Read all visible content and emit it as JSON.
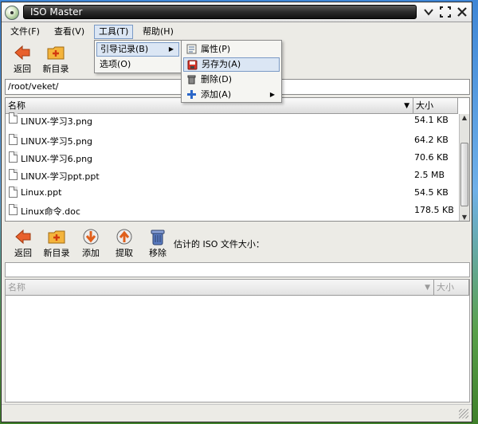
{
  "window": {
    "title": "ISO Master"
  },
  "window_controls": [
    "chevron-down-icon",
    "maximize-icon",
    "close-icon"
  ],
  "menubar": {
    "items": [
      {
        "label": "文件(F)"
      },
      {
        "label": "查看(V)"
      },
      {
        "label": "工具(T)"
      },
      {
        "label": "帮助(H)"
      }
    ]
  },
  "tools_menu": {
    "items": [
      {
        "label": "引导记录(B)",
        "has_submenu": true
      },
      {
        "label": "选项(O)"
      }
    ]
  },
  "boot_submenu": {
    "items": [
      {
        "label": "属性(P)",
        "icon": "properties-icon"
      },
      {
        "label": "另存为(A)",
        "icon": "save-as-icon",
        "highlighted": true
      },
      {
        "label": "删除(D)",
        "icon": "trash-icon"
      },
      {
        "label": "添加(A)",
        "icon": "plus-icon",
        "has_submenu": true
      }
    ]
  },
  "fs_toolbar": {
    "back_label": "返回",
    "new_dir_label": "新目录"
  },
  "fs_path": "/root/veket/",
  "fs_browser": {
    "columns": {
      "name": "名称",
      "size": "大小"
    },
    "rows": [
      {
        "name": "LINUX-学习3.png",
        "size": "54.1 KB"
      },
      {
        "name": "LINUX-学习5.png",
        "size": "64.2 KB"
      },
      {
        "name": "LINUX-学习6.png",
        "size": "70.6 KB"
      },
      {
        "name": "LINUX-学习ppt.ppt",
        "size": "2.5 MB"
      },
      {
        "name": "Linux.ppt",
        "size": "54.5 KB"
      },
      {
        "name": "Linux命令.doc",
        "size": "178.5 KB"
      }
    ]
  },
  "iso_toolbar": {
    "back_label": "返回",
    "new_dir_label": "新目录",
    "add_label": "添加",
    "extract_label": "提取",
    "remove_label": "移除",
    "iso_size_label": "估计的 ISO 文件大小："
  },
  "iso_path": "",
  "iso_browser": {
    "columns": {
      "name": "名称",
      "size": "大小"
    }
  },
  "colors": {
    "accent": "#dbe6f4",
    "accent_border": "#7a9ac6",
    "back_arrow": "#e8602c",
    "folder": "#f4b43c"
  }
}
